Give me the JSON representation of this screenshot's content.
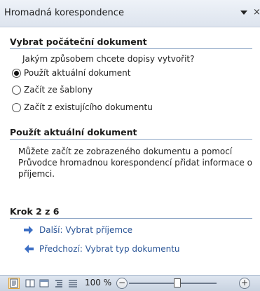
{
  "pane": {
    "title": "Hromadná korespondence",
    "close_glyph": "×"
  },
  "section1": {
    "heading": "Vybrat počáteční dokument",
    "question": "Jakým způsobem chcete dopisy vytvořit?",
    "options": [
      {
        "label": "Použít aktuální dokument",
        "checked": true
      },
      {
        "label": "Začít ze šablony",
        "checked": false
      },
      {
        "label": "Začít z existujícího dokumentu",
        "checked": false
      }
    ]
  },
  "section2": {
    "heading": "Použít aktuální dokument",
    "description": "Můžete začít ze zobrazeného dokumentu a pomocí Průvodce hromadnou korespondencí přidat informace o příjemci."
  },
  "step": {
    "heading": "Krok 2 z 6",
    "next_label": "Další: Vybrat příjemce",
    "prev_label": "Předchozí: Vybrat typ dokumentu"
  },
  "statusbar": {
    "zoom_label": "100 %",
    "zoom_minus": "−",
    "zoom_plus": "+"
  },
  "colors": {
    "link": "#2a5597",
    "arrow": "#3d6fc4",
    "rule": "#8fa7c7"
  },
  "icons": [
    "dropdown-arrow-icon",
    "close-icon",
    "arrow-right-icon",
    "arrow-left-icon",
    "print-layout-icon",
    "full-screen-reading-icon",
    "web-layout-icon",
    "outline-icon",
    "draft-icon"
  ]
}
